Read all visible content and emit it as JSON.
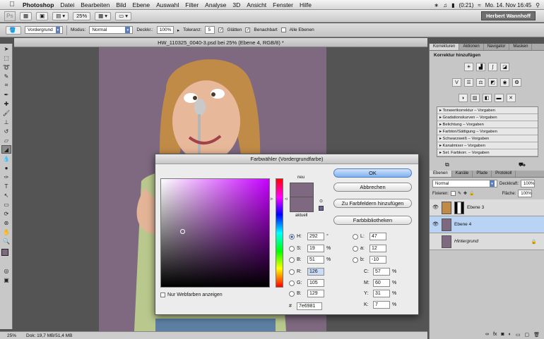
{
  "menubar": {
    "app_name": "Photoshop",
    "items": [
      "Datei",
      "Bearbeiten",
      "Bild",
      "Ebene",
      "Auswahl",
      "Filter",
      "Analyse",
      "3D",
      "Ansicht",
      "Fenster",
      "Hilfe"
    ],
    "battery": "(0:21)",
    "datetime": "Mo. 14. Nov 16:45"
  },
  "appbar": {
    "logo": "Ps",
    "zoom": "25%",
    "user": "Herbert Wannhoff"
  },
  "options": {
    "sample_mode": "Vordergrund",
    "mode_label": "Modus:",
    "mode_value": "Normal",
    "opacity_label": "Deckkr.:",
    "opacity_value": "100%",
    "tolerance_label": "Toleranz:",
    "tolerance_value": "5",
    "smooth_label": "Glätten",
    "contiguous_label": "Benachbart",
    "all_layers_label": "Alle Ebenen"
  },
  "document": {
    "title": "HW_110325_0040-3.psd bei 25% (Ebene 4, RGB/8) *",
    "canvas_color": "#7e6981"
  },
  "status": {
    "zoom": "25%",
    "doc": "Dok: 19,7 MB/51,4 MB"
  },
  "adjustments": {
    "tabs": [
      "Korrekturen",
      "Aktionen",
      "Navigator",
      "Masken"
    ],
    "heading": "Korrektur hinzufügen",
    "presets": [
      "Tonwertkorrektur – Vorgaben",
      "Gradationskurven – Vorgaben",
      "Belichtung – Vorgaben",
      "Farbton/Sättigung – Vorgaben",
      "Schwarzweiß – Vorgaben",
      "Kanalmixer – Vorgaben",
      "Sel. Farbkorr. – Vorgaben"
    ]
  },
  "layers": {
    "tabs": [
      "Ebenen",
      "Kanäle",
      "Pfade",
      "Protokoll"
    ],
    "blend_mode": "Normal",
    "opacity_label": "Deckkraft:",
    "opacity_value": "100%",
    "lock_label": "Fixieren:",
    "fill_label": "Fläche:",
    "fill_value": "100%",
    "items": [
      {
        "name": "Ebene 3"
      },
      {
        "name": "Ebene 4"
      },
      {
        "name": "Hintergrund"
      }
    ]
  },
  "color_picker": {
    "title": "Farbwähler (Vordergrundfarbe)",
    "new_label": "neu",
    "current_label": "aktuell",
    "new_color": "#7e6981",
    "current_color": "#7e6981",
    "ok": "OK",
    "cancel": "Abbrechen",
    "add_swatches": "Zu Farbfeldern hinzufügen",
    "libraries": "Farbbibliotheken",
    "web_only": "Nur Webfarben anzeigen",
    "h": {
      "label": "H:",
      "value": "292",
      "unit": "°"
    },
    "s": {
      "label": "S:",
      "value": "19",
      "unit": "%"
    },
    "b": {
      "label": "B:",
      "value": "51",
      "unit": "%"
    },
    "r": {
      "label": "R:",
      "value": "126"
    },
    "g": {
      "label": "G:",
      "value": "105"
    },
    "bl": {
      "label": "B:",
      "value": "129"
    },
    "lab_l": {
      "label": "L:",
      "value": "47"
    },
    "lab_a": {
      "label": "a:",
      "value": "12"
    },
    "lab_b": {
      "label": "b:",
      "value": "-10"
    },
    "c": {
      "label": "C:",
      "value": "57",
      "unit": "%"
    },
    "m": {
      "label": "M:",
      "value": "60",
      "unit": "%"
    },
    "y": {
      "label": "Y:",
      "value": "31",
      "unit": "%"
    },
    "k": {
      "label": "K:",
      "value": "7",
      "unit": "%"
    },
    "hex_label": "#",
    "hex": "7e6981"
  }
}
